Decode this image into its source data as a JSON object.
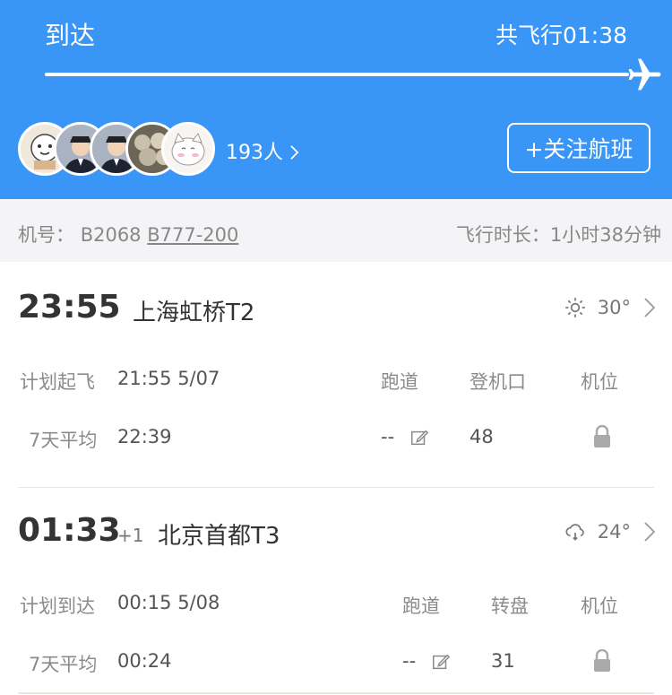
{
  "header": {
    "status": "到达",
    "total_flight": "共飞行01:38",
    "follower_count": "193人",
    "follow_button": "+关注航班"
  },
  "info": {
    "reg_label": "机号：",
    "reg_number": "B2068",
    "aircraft_model": "B777-200",
    "duration_label": "飞行时长：",
    "duration_value": "1小时38分钟"
  },
  "departure": {
    "time": "23:55",
    "airport": "上海虹桥T2",
    "weather_icon": "sun-icon",
    "temperature": "30°",
    "scheduled_label": "计划起飞",
    "scheduled_value": "21:55 5/07",
    "avg_label": "7天平均",
    "avg_value": "22:39",
    "col_runway": "跑道",
    "col_gate": "登机口",
    "col_stand": "机位",
    "runway": "--",
    "gate": "48"
  },
  "arrival": {
    "time": "01:33",
    "day_offset": "+1",
    "airport": "北京首都T3",
    "weather_icon": "cloud-rain-icon",
    "temperature": "24°",
    "scheduled_label": "计划到达",
    "scheduled_value": "00:15 5/08",
    "avg_label": "7天平均",
    "avg_value": "00:24",
    "col_runway": "跑道",
    "col_carousel": "转盘",
    "col_stand": "机位",
    "runway": "--",
    "carousel": "31"
  },
  "colors": {
    "header_blue": "#3996f6",
    "strip_gray": "#f4f4f6"
  }
}
